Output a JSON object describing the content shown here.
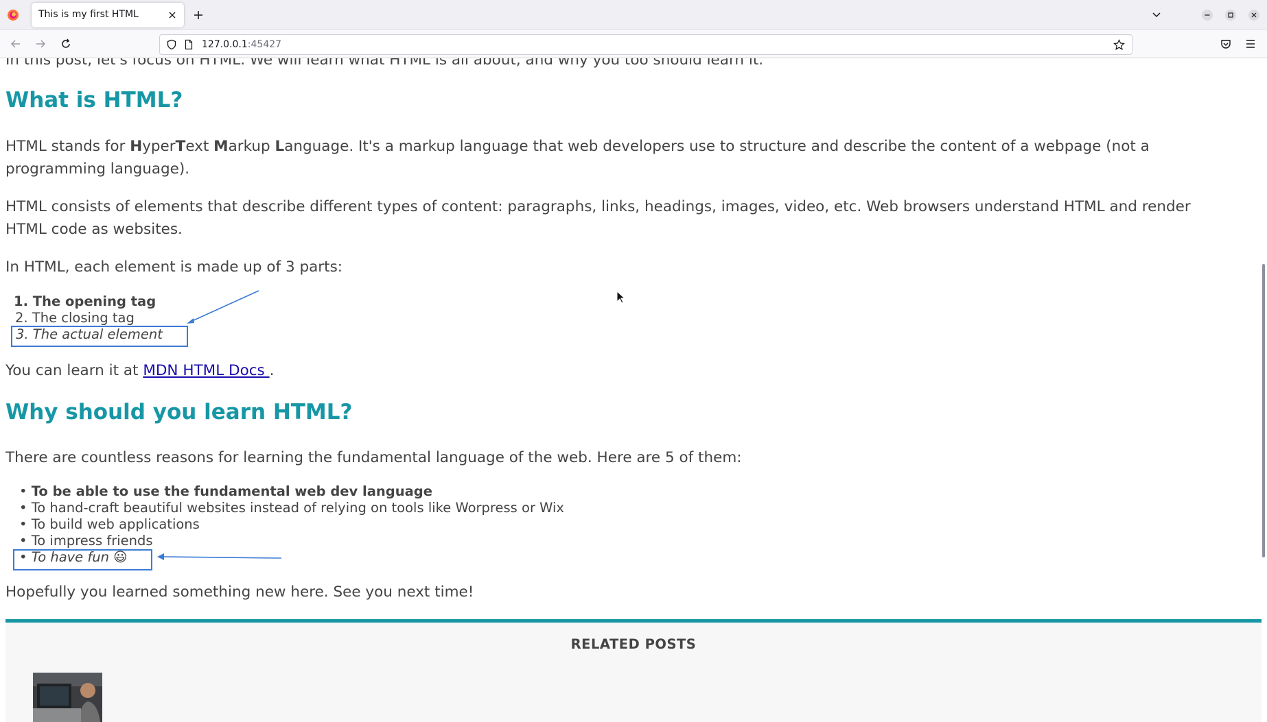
{
  "browser": {
    "tab_title": "This is my first HTML",
    "url_host": "127.0.0.1",
    "url_port": ":45427"
  },
  "article": {
    "intro_partial": "In this post, let's focus on HTML. We will learn what HTML is all about, and why you too should learn it.",
    "heading1": "What is HTML?",
    "para1": {
      "pre": "HTML stands for ",
      "h": "H",
      "yper": "yper",
      "t": "T",
      "ext": "ext ",
      "m": "M",
      "arkup": "arkup ",
      "l": "L",
      "line1_rest": "anguage. It's a markup language that web developers use to structure and describe the content of a webpage (not a",
      "line2": "programming language)."
    },
    "para2_line1": "HTML consists of elements that describe different types of content: paragraphs, links, headings, images, video, etc. Web browsers understand HTML and render",
    "para2_line2": "HTML code as websites.",
    "para3": "In HTML, each element is made up of 3 parts:",
    "parts": [
      "1. The opening tag",
      "2. The closing tag",
      "3. The actual element"
    ],
    "learn_pre": "You can learn it at ",
    "learn_link": "MDN HTML Docs ",
    "learn_post": ".",
    "heading2": "Why should you learn HTML?",
    "para4": "There are countless reasons for learning the fundamental language of the web. Here are 5 of them:",
    "reasons": [
      "To be able to use the fundamental web dev language",
      "To hand-craft beautiful websites instead of relying on tools like Worpress or Wix",
      "To build web applications",
      "To impress friends",
      "To have fun 😃"
    ],
    "closing": "Hopefully you learned something new here. See you next time!"
  },
  "related": {
    "title": "RELATED POSTS"
  },
  "colors": {
    "heading": "#1797a6",
    "text": "#444444",
    "link": "#1a0dab",
    "annotation": "#3a7bd5"
  }
}
